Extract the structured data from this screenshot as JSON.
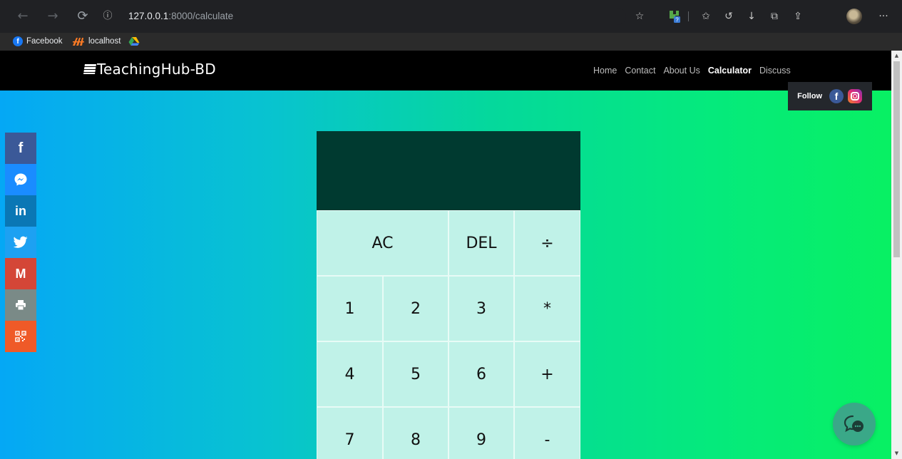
{
  "browser": {
    "url_host": "127.0.0.1",
    "url_rest": ":8000/calculate",
    "back_icon": "←",
    "forward_icon": "→",
    "reload_icon": "⟳",
    "info_icon": "ⓘ",
    "toolbar_icons": {
      "add_favorite": "☆",
      "favorites": "✩",
      "history": "↺",
      "downloads": "↓",
      "collections": "⧉",
      "share": "⇪",
      "menu": "···"
    }
  },
  "bookmarks": [
    {
      "label": "Facebook",
      "icon": "f"
    },
    {
      "label": "localhost",
      "icon": "xampp-icon"
    },
    {
      "label": "",
      "icon": "google-drive-icon"
    }
  ],
  "site": {
    "brand": "TeachingHub-BD",
    "nav": [
      {
        "label": "Home",
        "active": false
      },
      {
        "label": "Contact",
        "active": false
      },
      {
        "label": "About Us",
        "active": false
      },
      {
        "label": "Calculator",
        "active": true
      },
      {
        "label": "Discuss",
        "active": false
      }
    ],
    "follow_label": "Follow",
    "follow_fb": "f",
    "share_buttons": [
      {
        "name": "facebook",
        "glyph": "f",
        "color": "#3b5998"
      },
      {
        "name": "messenger",
        "glyph": "",
        "color": "#1a8cff"
      },
      {
        "name": "linkedin",
        "glyph": "in",
        "color": "#0a77b5"
      },
      {
        "name": "twitter",
        "glyph": "",
        "color": "#1da1f2"
      },
      {
        "name": "gmail",
        "glyph": "M",
        "color": "#d44637"
      },
      {
        "name": "print",
        "glyph": "",
        "color": "#7a8a87"
      },
      {
        "name": "qrcode",
        "glyph": "",
        "color": "#ef5a28"
      }
    ]
  },
  "calculator": {
    "display": "",
    "keys": {
      "ac": "AC",
      "del": "DEL",
      "divide": "÷",
      "one": "1",
      "two": "2",
      "three": "3",
      "multiply": "*",
      "four": "4",
      "five": "5",
      "six": "6",
      "plus": "+",
      "seven": "7",
      "eight": "8",
      "nine": "9",
      "minus": "-"
    }
  },
  "colors": {
    "hero_gradient": [
      "#05a8f5",
      "#08c3d0",
      "#05d89c",
      "#05ea7c",
      "#08f063"
    ],
    "calc_display": "#003a30",
    "calc_key": "#c0f2e8",
    "chat_button": "#3aa888"
  }
}
